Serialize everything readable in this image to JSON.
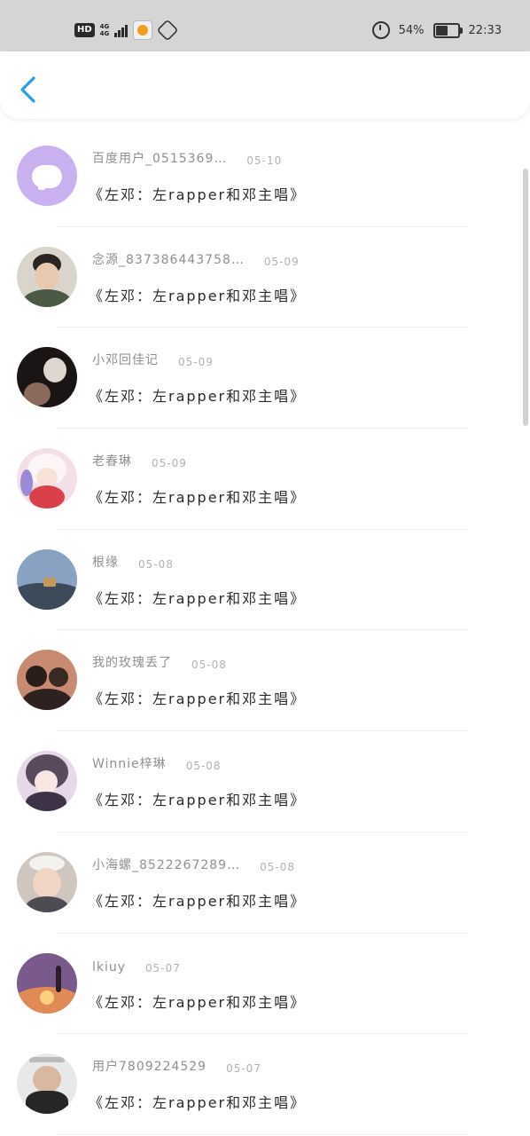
{
  "status_bar": {
    "hd": "HD",
    "network_top": "4G",
    "network_bottom": "4G",
    "battery_text": "54%",
    "battery_level": 0.54,
    "time": "22:33",
    "icons": [
      "hd-badge",
      "signal-icon",
      "app-notification-icon",
      "hexagon-app-icon",
      "alarm-icon",
      "battery-icon"
    ]
  },
  "header": {
    "back_icon": "chevron-left-icon",
    "accent_color": "#2b9de8"
  },
  "messages": [
    {
      "name": "百度用户_0515369…",
      "date": "05-10",
      "text": "《左邓：左rapper和邓主唱》",
      "avatar": "purple-chat-bubble"
    },
    {
      "name": "念源_837386443758…",
      "date": "05-09",
      "text": "《左邓：左rapper和邓主唱》",
      "avatar": "photo-boy"
    },
    {
      "name": "小邓回佳记",
      "date": "05-09",
      "text": "《左邓：左rapper和邓主唱》",
      "avatar": "photo-dark"
    },
    {
      "name": "老春琳",
      "date": "05-09",
      "text": "《左邓：左rapper和邓主唱》",
      "avatar": "anime-girl"
    },
    {
      "name": "根缘",
      "date": "05-08",
      "text": "《左邓：左rapper和邓主唱》",
      "avatar": "landscape"
    },
    {
      "name": "我的玫瑰丢了",
      "date": "05-08",
      "text": "《左邓：左rapper和邓主唱》",
      "avatar": "couple-silhouette"
    },
    {
      "name": "Winnie梓琳",
      "date": "05-08",
      "text": "《左邓：左rapper和邓主唱》",
      "avatar": "anime-catgirl"
    },
    {
      "name": "小海螺_8522267289…",
      "date": "05-08",
      "text": "《左邓：左rapper和邓主唱》",
      "avatar": "boy-with-hat"
    },
    {
      "name": "lkiuy",
      "date": "05-07",
      "text": "《左邓：左rapper和邓主唱》",
      "avatar": "sunset"
    },
    {
      "name": "用户7809224529",
      "date": "05-07",
      "text": "《左邓：左rapper和邓主唱》",
      "avatar": "photo-man"
    }
  ]
}
